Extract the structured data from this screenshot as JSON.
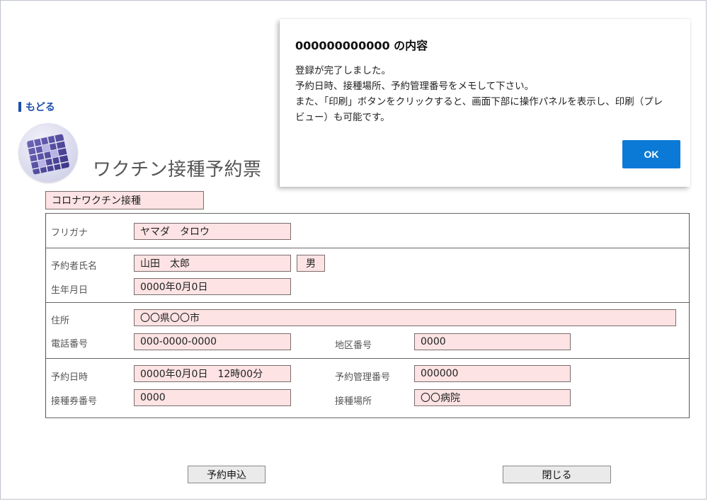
{
  "nav": {
    "back_label": "もどる"
  },
  "page": {
    "title": "ワクチン接種予約票"
  },
  "vaccine_type": {
    "value": "コロナワクチン接種"
  },
  "furigana": {
    "label": "フリガナ",
    "value": "ヤマダ　タロウ"
  },
  "name": {
    "label": "予約者氏名",
    "value": "山田　太郎",
    "sex": "男"
  },
  "birth": {
    "label": "生年月日",
    "value": "0000年0月0日"
  },
  "address": {
    "label": "住所",
    "value": "〇〇県〇〇市"
  },
  "phone": {
    "label": "電話番号",
    "value": "000-0000-0000"
  },
  "district": {
    "label": "地区番号",
    "value": "0000"
  },
  "reserve_datetime": {
    "label": "予約日時",
    "value": "0000年0月0日　12時00分"
  },
  "reserve_number": {
    "label": "予約管理番号",
    "value": "000000"
  },
  "ticket_number": {
    "label": "接種券番号",
    "value": "0000"
  },
  "location": {
    "label": "接種場所",
    "value": "〇〇病院"
  },
  "buttons": {
    "submit": "予約申込",
    "close": "閉じる"
  },
  "dialog": {
    "title": "000000000000 の内容",
    "lines": [
      "登録が完了しました。",
      "予約日時、接種場所、予約管理番号をメモして下さい。",
      "また、「印刷」ボタンをクリックすると、画面下部に操作パネルを表示し、印刷（プレ",
      "ビュー）も可能です。"
    ],
    "ok": "OK"
  },
  "colors": {
    "field_bg": "#fde3e3",
    "ok_button": "#0b7ad6",
    "link": "#1d4ea8"
  }
}
